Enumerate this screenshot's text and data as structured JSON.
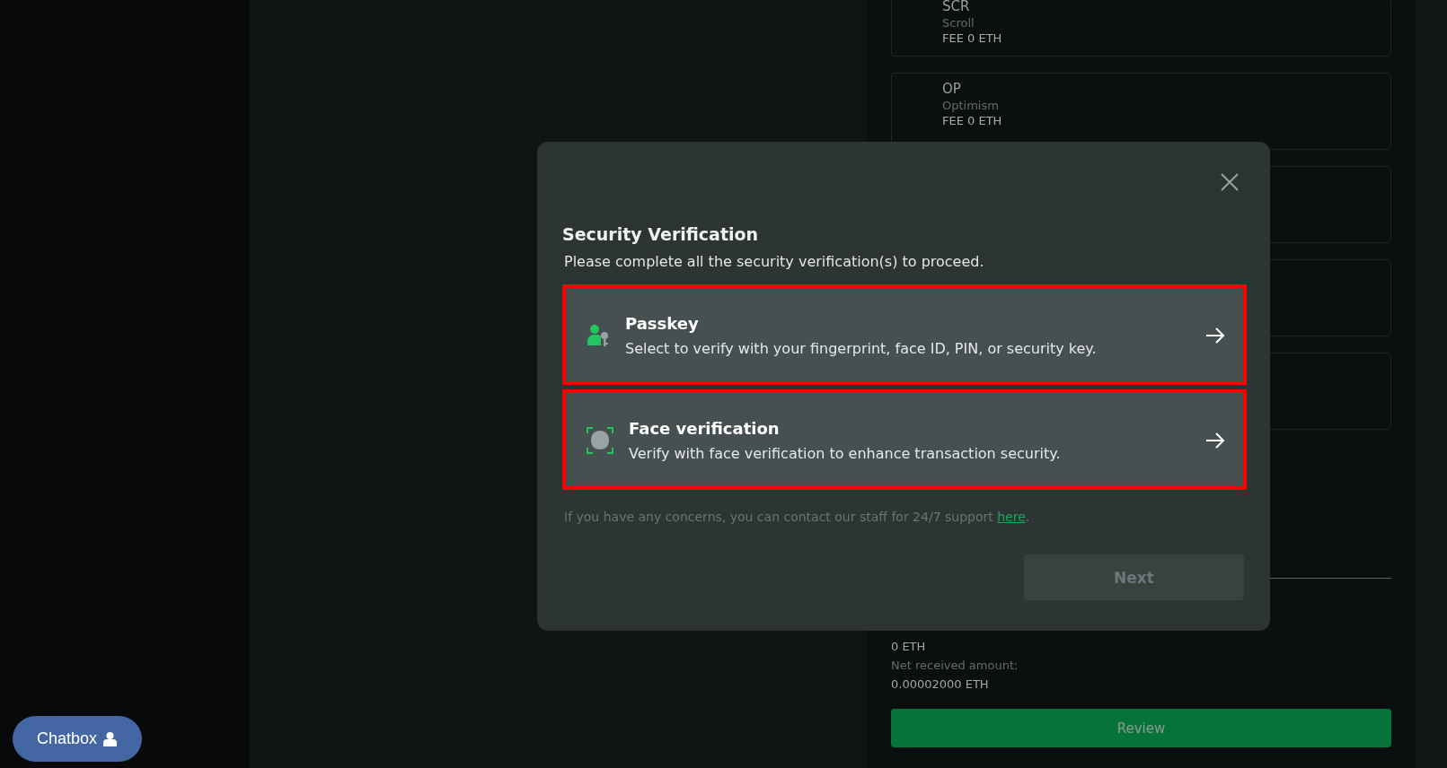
{
  "networks": [
    {
      "kind": "network",
      "symbol": "SCR",
      "name": "Scroll",
      "fee": "FEE 0 ETH"
    },
    {
      "kind": "network",
      "symbol": "OP",
      "name": "Optimism",
      "fee": "FEE 0 ETH"
    },
    {
      "kind": "blank"
    },
    {
      "kind": "blank"
    },
    {
      "kind": "blank"
    }
  ],
  "summary": [
    {
      "kind": "value",
      "text": "0 ETH"
    },
    {
      "kind": "label",
      "text": "Net received amount:"
    },
    {
      "kind": "value",
      "text": "0.00002000 ETH"
    }
  ],
  "review_button": {
    "label": "Review",
    "disabled": true
  },
  "dialog": {
    "title": "Security Verification",
    "subtitle": "Please complete all the security verification(s) to proceed.",
    "options": [
      {
        "kind": "passkey",
        "title": "Passkey",
        "description": "Select to verify with your fingerprint, face ID, PIN, or security key.",
        "highlighted": true
      },
      {
        "kind": "face",
        "title": "Face verification",
        "description": "Verify with face verification to enhance transaction security.",
        "highlighted": true
      }
    ],
    "footer": {
      "text": "If you have any concerns, you can contact our staff for 24/7 support ",
      "link": "here",
      "end": "."
    },
    "next_button": {
      "label": "Next",
      "disabled": true
    }
  },
  "chatbox": {
    "label": "Chatbox"
  }
}
